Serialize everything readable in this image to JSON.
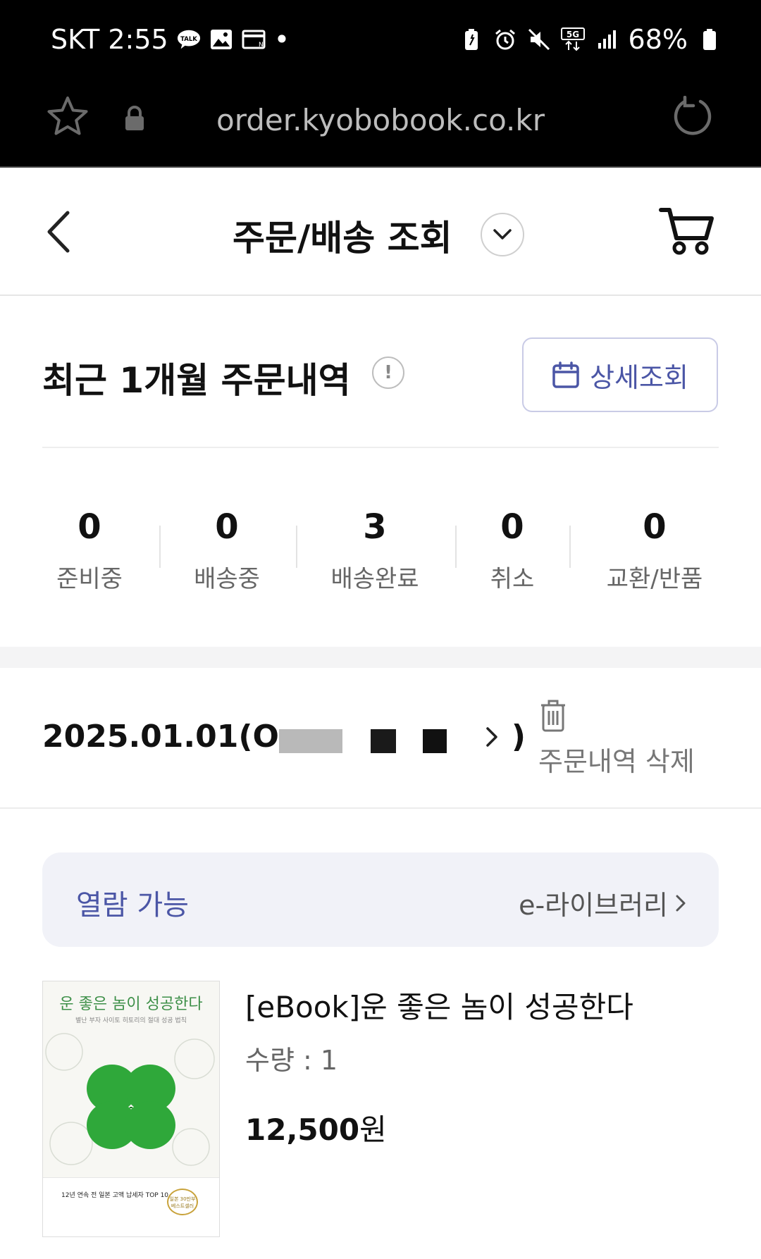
{
  "status_bar": {
    "carrier_time": "SKT 2:55",
    "dot": "•",
    "network": "5G",
    "battery": "68%"
  },
  "browser": {
    "url": "order.kyobobook.co.kr"
  },
  "header": {
    "title": "주문/배송 조회"
  },
  "recent": {
    "title": "최근 1개월 주문내역",
    "info": "!",
    "detail_button": "상세조회"
  },
  "stats": [
    {
      "count": "0",
      "label": "준비중"
    },
    {
      "count": "0",
      "label": "배송중"
    },
    {
      "count": "3",
      "label": "배송완료"
    },
    {
      "count": "0",
      "label": "취소"
    },
    {
      "count": "0",
      "label": "교환/반품"
    }
  ],
  "order": {
    "date_prefix": "2025.01.01(O",
    "date_suffix": ")",
    "delete_label": "주문내역 삭제"
  },
  "availability": {
    "status": "열람 가능",
    "library_link": "e-라이브러리"
  },
  "product": {
    "title": "[eBook]운 좋은 놈이 성공한다",
    "quantity": "수량 : 1",
    "price_number": "12,500",
    "price_unit": "원",
    "cover_title": "운 좋은 놈이 성공한다",
    "cover_subtitle": "별난 부자 사이토 히토리의 절대 성공 법칙",
    "cover_band": "12년 연속 전 일본 고액 납세자 TOP 10",
    "cover_seal": "일본 30만부 베스트셀러"
  },
  "colors": {
    "accent": "#4b56a6",
    "status_bar": "#000000",
    "panel": "#f1f2f8"
  }
}
